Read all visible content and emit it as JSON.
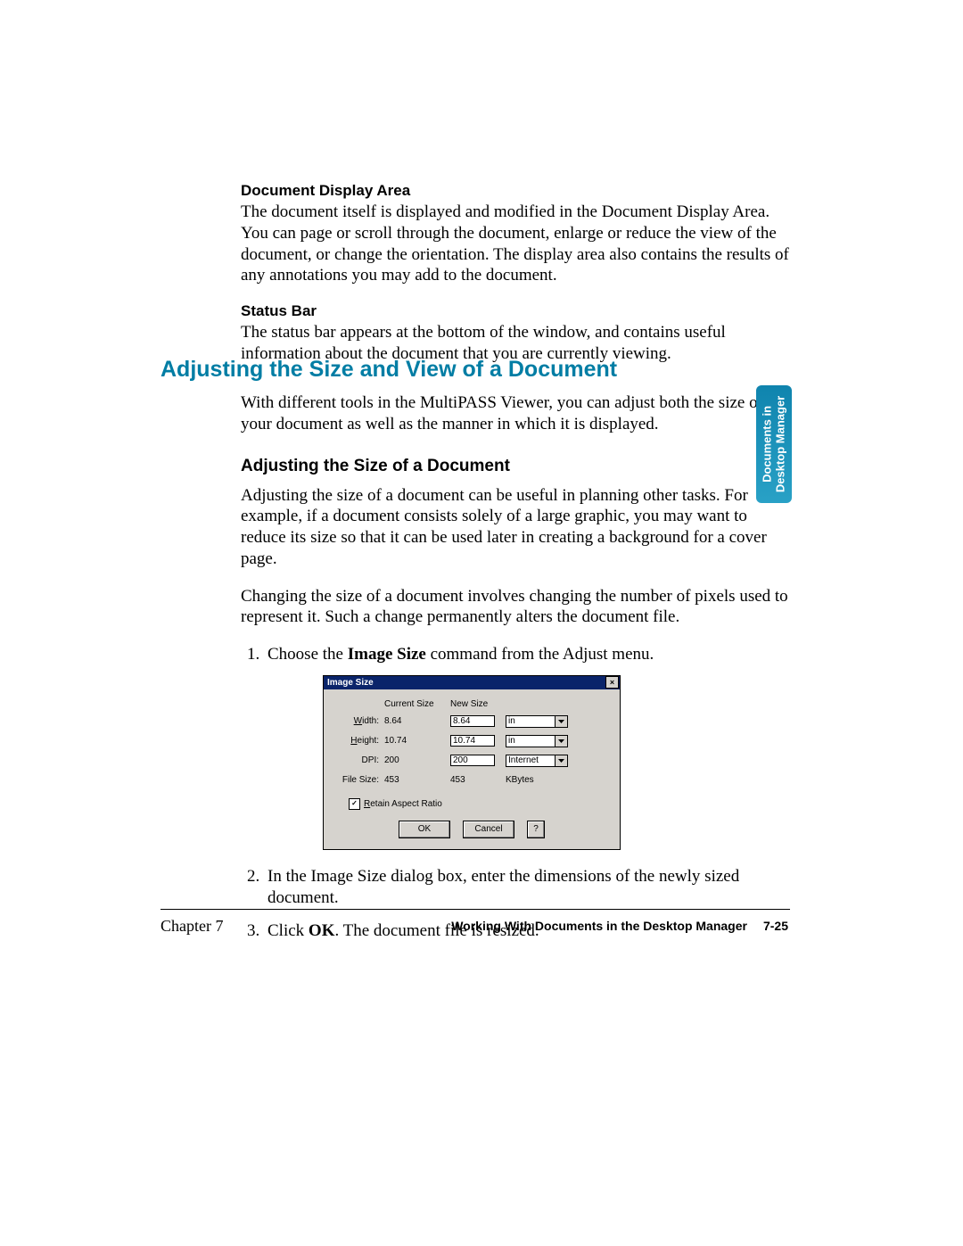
{
  "sections": {
    "display_area": {
      "label": "Document Display Area",
      "body": "The document itself is displayed and modified in the Document Display Area. You can page or scroll through the document, enlarge or reduce the view of the document, or change the orientation. The display area also contains the results of any annotations you may add to the document."
    },
    "status_bar": {
      "label": "Status Bar",
      "body": "The status bar appears at the bottom of the window, and contains useful information about the document that you are currently viewing."
    }
  },
  "heading1": "Adjusting the Size and View of a Document",
  "intro_para": "With different tools in the MultiPASS Viewer, you can adjust both the size of your document as well as the manner in which it is displayed.",
  "heading2": "Adjusting the Size of a Document",
  "para_a": "Adjusting the size of a document can be useful in planning other tasks. For example, if a document consists solely of a large graphic, you may want to reduce its size so that it can be used later in creating a background for a cover page.",
  "para_b": "Changing the size of a document involves changing the number of pixels used to represent it. Such a change permanently alters the document file.",
  "steps": {
    "s1_pre": "Choose the ",
    "s1_bold": "Image Size",
    "s1_post": " command from the Adjust menu.",
    "s2": "In the Image Size dialog box, enter the dimensions of the newly sized document.",
    "s3_pre": "Click ",
    "s3_bold": "OK",
    "s3_post": ". The document file is resized."
  },
  "dialog": {
    "title": "Image Size",
    "close": "×",
    "col_current": "Current Size",
    "col_new": "New Size",
    "rows": {
      "width": {
        "label_u": "W",
        "label_rest": "idth:",
        "current": "8.64",
        "new": "8.64",
        "unit": "in",
        "unit_combo": true
      },
      "height": {
        "label_u": "H",
        "label_rest": "eight:",
        "current": "10.74",
        "new": "10.74",
        "unit": "in",
        "unit_combo": true
      },
      "dpi": {
        "label_u": "",
        "label_rest": "DPI:",
        "current": "200",
        "new": "200",
        "unit": "Internet",
        "unit_combo": true
      },
      "filesize": {
        "label_u": "",
        "label_rest": "File Size:",
        "current": "453",
        "new": "453",
        "unit": "KBytes",
        "unit_combo": false
      }
    },
    "retain_u": "R",
    "retain_rest": "etain Aspect Ratio",
    "retain_checked": "✓",
    "buttons": {
      "ok": "OK",
      "cancel": "Cancel",
      "help": "?"
    }
  },
  "side_tab": {
    "line1": "Documents in",
    "line2": "Desktop Manager"
  },
  "footer": {
    "chapter": "Chapter 7",
    "section": "Working With Documents in the Desktop Manager",
    "page": "7-25"
  }
}
